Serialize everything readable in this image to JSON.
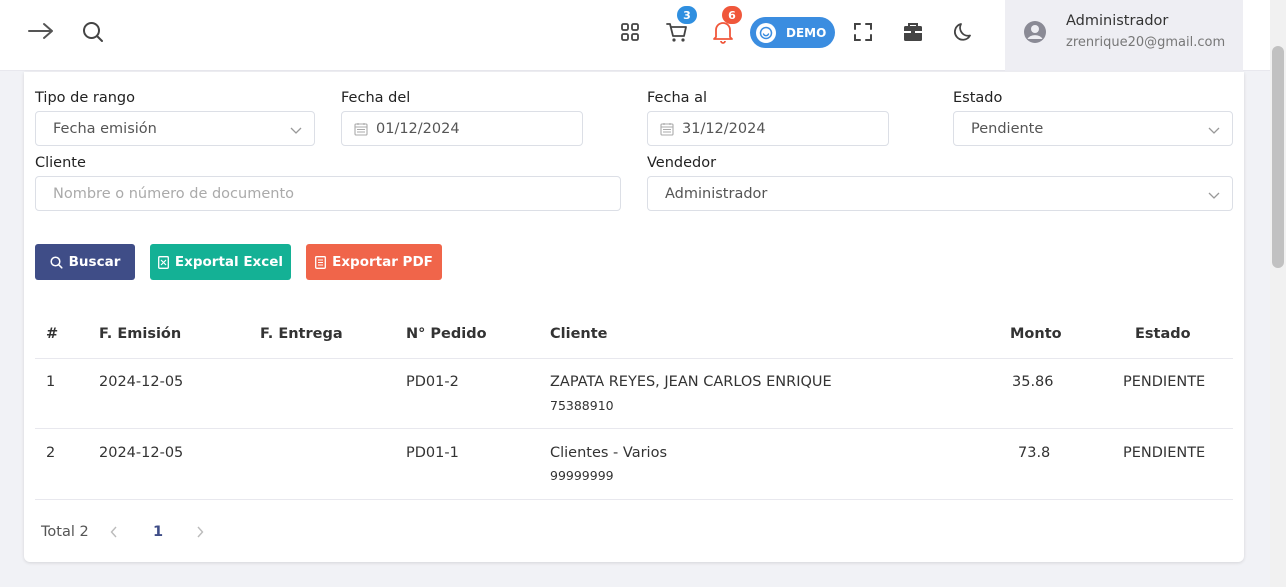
{
  "header": {
    "cart_badge": "3",
    "bell_badge": "6",
    "demo_label": "DEMO",
    "user_name": "Administrador",
    "user_email": "zrenrique20@gmail.com",
    "colors": {
      "cart_badge": "#2f8fe0",
      "bell_badge": "#f0573b",
      "demo": "#3b8de0"
    }
  },
  "filters": {
    "range_type": {
      "label": "Tipo de rango",
      "value": "Fecha emisión"
    },
    "date_from": {
      "label": "Fecha del",
      "value": "01/12/2024"
    },
    "date_to": {
      "label": "Fecha al",
      "value": "31/12/2024"
    },
    "status": {
      "label": "Estado",
      "value": "Pendiente"
    },
    "client": {
      "label": "Cliente",
      "placeholder": "Nombre o número de documento"
    },
    "seller": {
      "label": "Vendedor",
      "value": "Administrador"
    }
  },
  "actions": {
    "search": "Buscar",
    "excel": "Exportal Excel",
    "pdf": "Exportar PDF",
    "colors": {
      "search": "#3f4d87",
      "excel": "#14b195",
      "pdf": "#f0654a"
    }
  },
  "table": {
    "headers": [
      "#",
      "F. Emisión",
      "F. Entrega",
      "N° Pedido",
      "Cliente",
      "Monto",
      "Estado"
    ],
    "rows": [
      {
        "num": "1",
        "emision": "2024-12-05",
        "entrega": "",
        "pedido": "PD01-2",
        "cliente": "ZAPATA REYES, JEAN CARLOS ENRIQUE",
        "documento": "75388910",
        "monto": "35.86",
        "estado": "PENDIENTE"
      },
      {
        "num": "2",
        "emision": "2024-12-05",
        "entrega": "",
        "pedido": "PD01-1",
        "cliente": "Clientes - Varios",
        "documento": "99999999",
        "monto": "73.8",
        "estado": "PENDIENTE"
      }
    ]
  },
  "pagination": {
    "total": "Total 2",
    "current_page": "1"
  }
}
